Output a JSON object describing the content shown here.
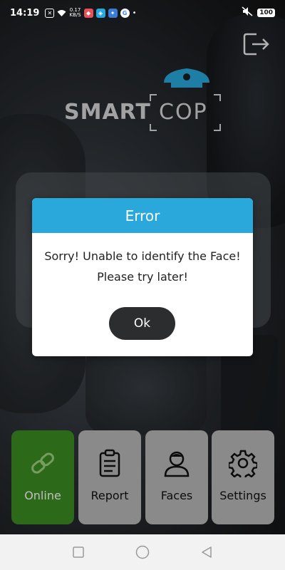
{
  "status_bar": {
    "time": "14:19",
    "net_speed": "0.17\nKB/S",
    "battery": "100"
  },
  "logo": {
    "word1": "SMART",
    "word2": "COP"
  },
  "dialog": {
    "title": "Error",
    "message_line1": "Sorry! Unable to identify the Face!",
    "message_line2": "Please try later!",
    "ok_label": "Ok"
  },
  "menu": {
    "online_label": "Online",
    "report_label": "Report",
    "faces_label": "Faces",
    "settings_label": "Settings"
  },
  "colors": {
    "accent": "#2aa8dc",
    "active_tile": "#3b8d22",
    "tile": "#b9b9b9",
    "ok_button": "#2b2d2f"
  },
  "icons": [
    "exit-icon",
    "link-icon",
    "clipboard-icon",
    "person-icon",
    "gear-icon"
  ]
}
